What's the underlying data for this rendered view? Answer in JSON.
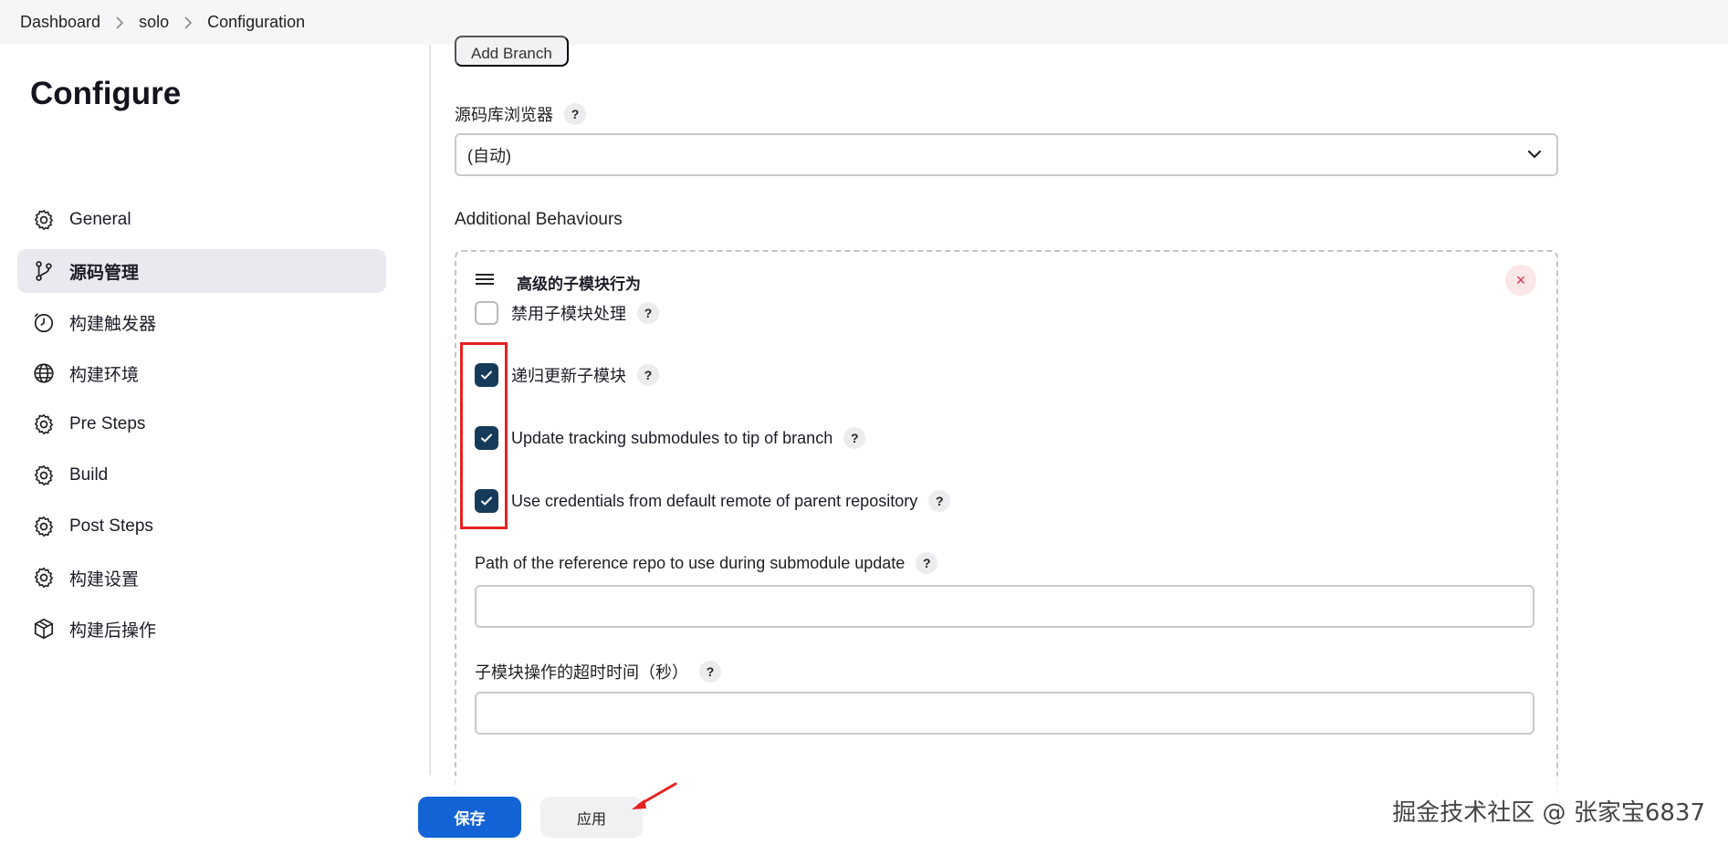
{
  "breadcrumb": {
    "items": [
      "Dashboard",
      "solo",
      "Configuration"
    ]
  },
  "sidebar": {
    "title": "Configure",
    "items": [
      {
        "label": "General",
        "icon": "gear-icon",
        "active": false
      },
      {
        "label": "源码管理",
        "icon": "branch-icon",
        "active": true
      },
      {
        "label": "构建触发器",
        "icon": "clock-icon",
        "active": false
      },
      {
        "label": "构建环境",
        "icon": "globe-icon",
        "active": false
      },
      {
        "label": "Pre Steps",
        "icon": "gear-icon",
        "active": false
      },
      {
        "label": "Build",
        "icon": "gear-icon",
        "active": false
      },
      {
        "label": "Post Steps",
        "icon": "gear-icon",
        "active": false
      },
      {
        "label": "构建设置",
        "icon": "gear-icon",
        "active": false
      },
      {
        "label": "构建后操作",
        "icon": "package-icon",
        "active": false
      }
    ]
  },
  "main": {
    "add_branch_label": "Add Branch",
    "repo_browser": {
      "label": "源码库浏览器",
      "help": "?",
      "selected": "(自动)"
    },
    "additional_behaviours_label": "Additional Behaviours",
    "behaviour": {
      "title": "高级的子模块行为",
      "remove": "×",
      "options": [
        {
          "label": "禁用子模块处理",
          "checked": false,
          "help": "?"
        },
        {
          "label": "递归更新子模块",
          "checked": true,
          "help": "?"
        },
        {
          "label": "Update tracking submodules to tip of branch",
          "checked": true,
          "help": "?"
        },
        {
          "label": "Use credentials from default remote of parent repository",
          "checked": true,
          "help": "?"
        }
      ],
      "reference_repo": {
        "label": "Path of the reference repo to use during submodule update",
        "help": "?",
        "value": ""
      },
      "timeout": {
        "label": "子模块操作的超时时间（秒）",
        "help": "?",
        "value": ""
      }
    }
  },
  "actions": {
    "save_label": "保存",
    "apply_label": "应用"
  },
  "credit": "掘金技术社区 @ 张家宝6837",
  "colors": {
    "primary": "#1463d6",
    "checkbox_checked": "#163a5a",
    "highlight_frame": "#e52222",
    "arrow": "#e52222"
  }
}
